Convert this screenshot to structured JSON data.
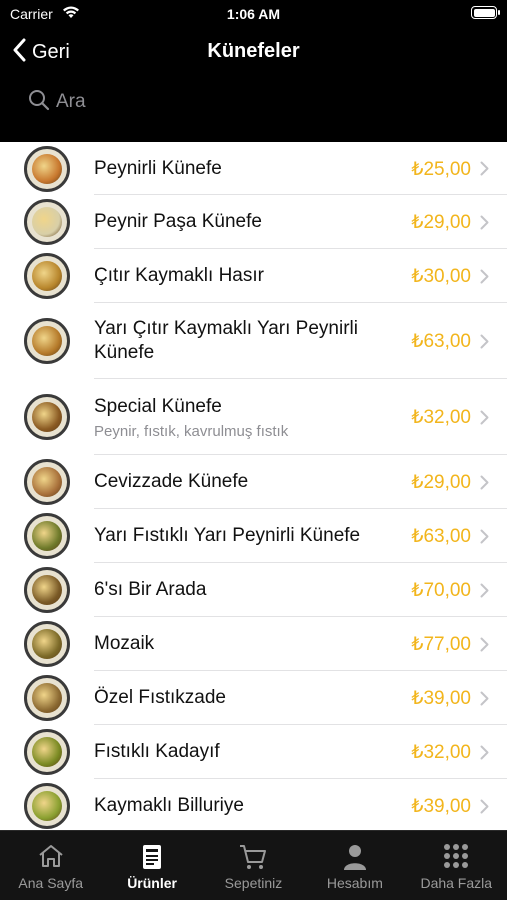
{
  "status_bar": {
    "carrier": "Carrier",
    "time": "1:06 AM"
  },
  "nav": {
    "back_label": "Geri",
    "title": "Künefeler"
  },
  "search": {
    "placeholder": "Ara"
  },
  "items": [
    {
      "name": "Peynirli Künefe",
      "description": "",
      "price": "₺25,00",
      "thumb_color": "#c8782e"
    },
    {
      "name": "Peynir Paşa Künefe",
      "description": "",
      "price": "₺29,00",
      "thumb_color": "#d8cfa8"
    },
    {
      "name": "Çıtır Kaymaklı Hasır",
      "description": "",
      "price": "₺30,00",
      "thumb_color": "#b8862c"
    },
    {
      "name": "Yarı Çıtır Kaymaklı Yarı Peynirli Künefe",
      "description": "",
      "price": "₺63,00",
      "thumb_color": "#b57a2a"
    },
    {
      "name": "Special Künefe",
      "description": "Peynir, fıstık, kavrulmuş fıstık",
      "price": "₺32,00",
      "thumb_color": "#8a5a22"
    },
    {
      "name": "Cevizzade Künefe",
      "description": "",
      "price": "₺29,00",
      "thumb_color": "#a8703a"
    },
    {
      "name": "Yarı Fıstıklı Yarı Peynirli Künefe",
      "description": "",
      "price": "₺63,00",
      "thumb_color": "#6e7a2a"
    },
    {
      "name": "6'sı Bir Arada",
      "description": "",
      "price": "₺70,00",
      "thumb_color": "#7a5a26"
    },
    {
      "name": "Mozaik",
      "description": "",
      "price": "₺77,00",
      "thumb_color": "#7c6a28"
    },
    {
      "name": "Özel Fıstıkzade",
      "description": "",
      "price": "₺39,00",
      "thumb_color": "#8c6a32"
    },
    {
      "name": "Fıstıklı Kadayıf",
      "description": "",
      "price": "₺32,00",
      "thumb_color": "#7a8a22"
    },
    {
      "name": "Kaymaklı Billuriye",
      "description": "",
      "price": "₺39,00",
      "thumb_color": "#8aa030"
    }
  ],
  "tabs": [
    {
      "label": "Ana Sayfa",
      "icon": "home-icon",
      "active": false
    },
    {
      "label": "Ürünler",
      "icon": "menu-icon",
      "active": true
    },
    {
      "label": "Sepetiniz",
      "icon": "cart-icon",
      "active": false
    },
    {
      "label": "Hesabım",
      "icon": "person-icon",
      "active": false
    },
    {
      "label": "Daha Fazla",
      "icon": "grid-icon",
      "active": false
    }
  ],
  "colors": {
    "accent_price": "#f2b51c",
    "background_dark": "#000000",
    "tabbar": "#141414"
  }
}
